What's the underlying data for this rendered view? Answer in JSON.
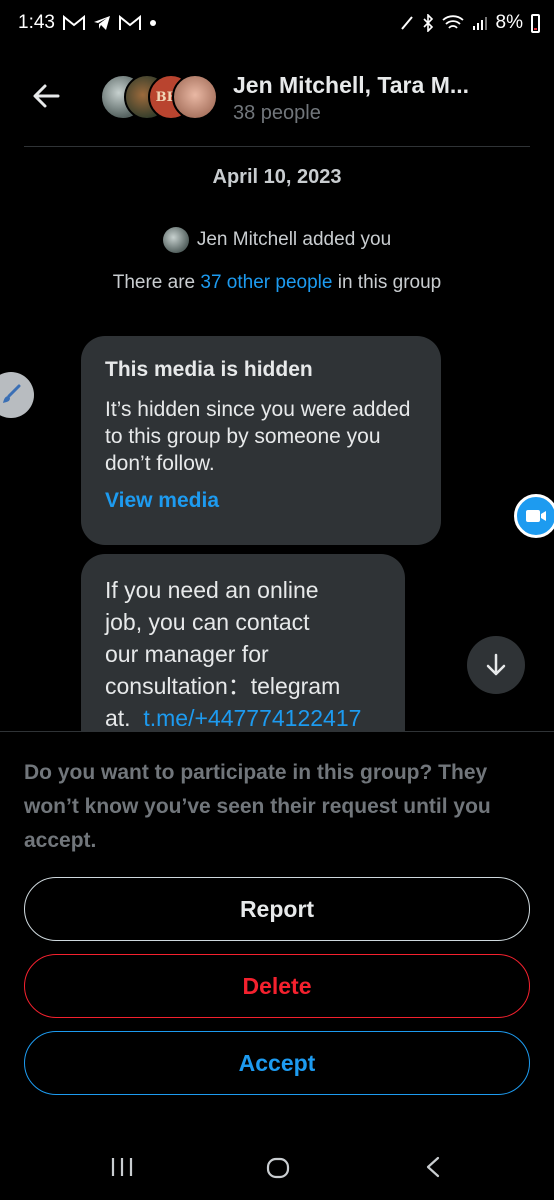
{
  "status_bar": {
    "time": "1:43",
    "battery": "8%",
    "icons": [
      "gmail-icon",
      "telegram-icon",
      "gmail-icon",
      "dot-icon",
      "pen-icon",
      "bluetooth-icon",
      "wifi-icon",
      "signal-icon",
      "battery-icon"
    ]
  },
  "header": {
    "title": "Jen Mitchell, Tara M...",
    "subtitle": "38 people",
    "avatar3_text": "BEE"
  },
  "conversation": {
    "date": "April 10, 2023",
    "added_text": "Jen Mitchell added you",
    "group_info": {
      "prefix": "There are ",
      "link": "37 other people",
      "suffix": " in this group"
    },
    "hidden_media": {
      "title": "This media is hidden",
      "body": "It’s hidden since you were added to this group by someone you don’t follow.",
      "link": "View media"
    },
    "message": {
      "line1": "If you need an online",
      "line2": "job, you can contact",
      "line3": "our manager for",
      "line4": "consultation：telegram",
      "line5_prefix": "at.  ",
      "line5_link": "t.me/+447774122417"
    }
  },
  "request_sheet": {
    "prompt": "Do you want to participate in this group? They won’t know you’ve seen their request until you accept.",
    "report_label": "Report",
    "delete_label": "Delete",
    "accept_label": "Accept"
  },
  "colors": {
    "accent": "#1d9bf0",
    "danger": "#f4212e",
    "background": "#000000",
    "bubble": "#2f3336",
    "muted_text": "#71767b"
  }
}
